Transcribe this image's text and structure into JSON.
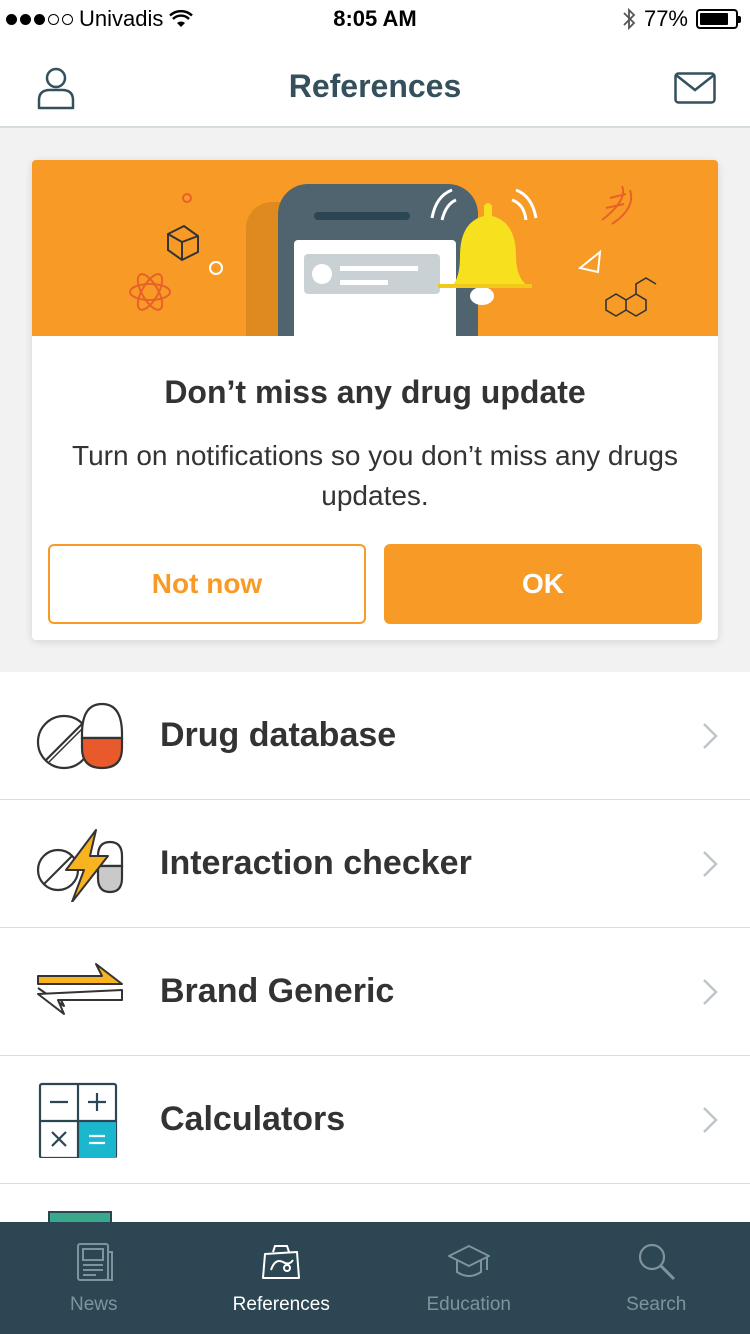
{
  "status_bar": {
    "carrier": "Univadis",
    "time": "8:05 AM",
    "battery": "77%"
  },
  "header": {
    "title": "References"
  },
  "card": {
    "title": "Don’t miss any drug update",
    "body": "Turn on notifications so you don’t miss any drugs updates.",
    "secondary_button": "Not now",
    "primary_button": "OK"
  },
  "list": [
    {
      "label": "Drug database",
      "icon": "pill-capsule-icon"
    },
    {
      "label": "Interaction checker",
      "icon": "lightning-pill-icon"
    },
    {
      "label": "Brand Generic",
      "icon": "swap-arrows-icon"
    },
    {
      "label": "Calculators",
      "icon": "calculator-icon"
    }
  ],
  "tabs": [
    {
      "label": "News",
      "icon": "newspaper-icon",
      "active": false
    },
    {
      "label": "References",
      "icon": "references-bag-icon",
      "active": true
    },
    {
      "label": "Education",
      "icon": "graduation-cap-icon",
      "active": false
    },
    {
      "label": "Search",
      "icon": "search-icon",
      "active": false
    }
  ],
  "colors": {
    "accent": "#f89b26",
    "navy": "#2d4653",
    "title": "#34505c"
  }
}
